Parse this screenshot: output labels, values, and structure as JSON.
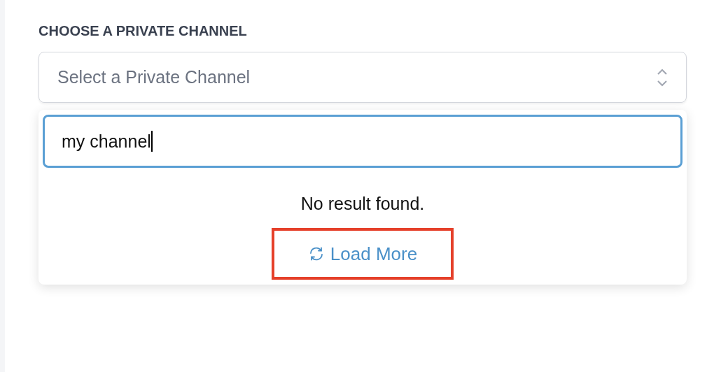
{
  "label": "CHOOSE A PRIVATE CHANNEL",
  "select": {
    "placeholder": "Select a Private Channel",
    "expanded": true
  },
  "search": {
    "value": "my channel",
    "focused": true
  },
  "message": "No result found.",
  "load_more": {
    "label": "Load More",
    "highlighted": true
  }
}
